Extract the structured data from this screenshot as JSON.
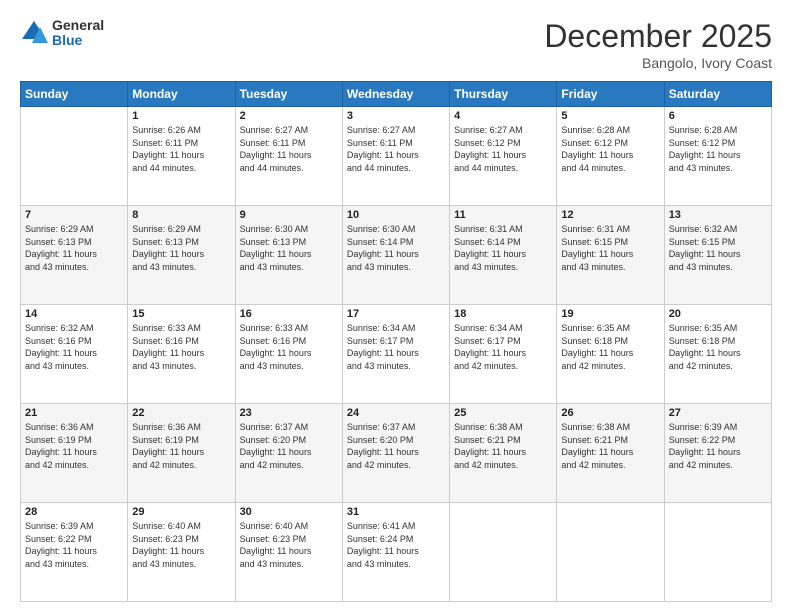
{
  "header": {
    "logo": {
      "general": "General",
      "blue": "Blue"
    },
    "title": "December 2025",
    "location": "Bangolo, Ivory Coast"
  },
  "calendar": {
    "days_of_week": [
      "Sunday",
      "Monday",
      "Tuesday",
      "Wednesday",
      "Thursday",
      "Friday",
      "Saturday"
    ],
    "weeks": [
      [
        {
          "day": "",
          "info": ""
        },
        {
          "day": "1",
          "info": "Sunrise: 6:26 AM\nSunset: 6:11 PM\nDaylight: 11 hours and 44 minutes."
        },
        {
          "day": "2",
          "info": "Sunrise: 6:27 AM\nSunset: 6:11 PM\nDaylight: 11 hours and 44 minutes."
        },
        {
          "day": "3",
          "info": "Sunrise: 6:27 AM\nSunset: 6:11 PM\nDaylight: 11 hours and 44 minutes."
        },
        {
          "day": "4",
          "info": "Sunrise: 6:27 AM\nSunset: 6:12 PM\nDaylight: 11 hours and 44 minutes."
        },
        {
          "day": "5",
          "info": "Sunrise: 6:28 AM\nSunset: 6:12 PM\nDaylight: 11 hours and 44 minutes."
        },
        {
          "day": "6",
          "info": "Sunrise: 6:28 AM\nSunset: 6:12 PM\nDaylight: 11 hours and 43 minutes."
        }
      ],
      [
        {
          "day": "7",
          "info": "Sunrise: 6:29 AM\nSunset: 6:13 PM\nDaylight: 11 hours and 43 minutes."
        },
        {
          "day": "8",
          "info": "Sunrise: 6:29 AM\nSunset: 6:13 PM\nDaylight: 11 hours and 43 minutes."
        },
        {
          "day": "9",
          "info": "Sunrise: 6:30 AM\nSunset: 6:13 PM\nDaylight: 11 hours and 43 minutes."
        },
        {
          "day": "10",
          "info": "Sunrise: 6:30 AM\nSunset: 6:14 PM\nDaylight: 11 hours and 43 minutes."
        },
        {
          "day": "11",
          "info": "Sunrise: 6:31 AM\nSunset: 6:14 PM\nDaylight: 11 hours and 43 minutes."
        },
        {
          "day": "12",
          "info": "Sunrise: 6:31 AM\nSunset: 6:15 PM\nDaylight: 11 hours and 43 minutes."
        },
        {
          "day": "13",
          "info": "Sunrise: 6:32 AM\nSunset: 6:15 PM\nDaylight: 11 hours and 43 minutes."
        }
      ],
      [
        {
          "day": "14",
          "info": "Sunrise: 6:32 AM\nSunset: 6:16 PM\nDaylight: 11 hours and 43 minutes."
        },
        {
          "day": "15",
          "info": "Sunrise: 6:33 AM\nSunset: 6:16 PM\nDaylight: 11 hours and 43 minutes."
        },
        {
          "day": "16",
          "info": "Sunrise: 6:33 AM\nSunset: 6:16 PM\nDaylight: 11 hours and 43 minutes."
        },
        {
          "day": "17",
          "info": "Sunrise: 6:34 AM\nSunset: 6:17 PM\nDaylight: 11 hours and 43 minutes."
        },
        {
          "day": "18",
          "info": "Sunrise: 6:34 AM\nSunset: 6:17 PM\nDaylight: 11 hours and 42 minutes."
        },
        {
          "day": "19",
          "info": "Sunrise: 6:35 AM\nSunset: 6:18 PM\nDaylight: 11 hours and 42 minutes."
        },
        {
          "day": "20",
          "info": "Sunrise: 6:35 AM\nSunset: 6:18 PM\nDaylight: 11 hours and 42 minutes."
        }
      ],
      [
        {
          "day": "21",
          "info": "Sunrise: 6:36 AM\nSunset: 6:19 PM\nDaylight: 11 hours and 42 minutes."
        },
        {
          "day": "22",
          "info": "Sunrise: 6:36 AM\nSunset: 6:19 PM\nDaylight: 11 hours and 42 minutes."
        },
        {
          "day": "23",
          "info": "Sunrise: 6:37 AM\nSunset: 6:20 PM\nDaylight: 11 hours and 42 minutes."
        },
        {
          "day": "24",
          "info": "Sunrise: 6:37 AM\nSunset: 6:20 PM\nDaylight: 11 hours and 42 minutes."
        },
        {
          "day": "25",
          "info": "Sunrise: 6:38 AM\nSunset: 6:21 PM\nDaylight: 11 hours and 42 minutes."
        },
        {
          "day": "26",
          "info": "Sunrise: 6:38 AM\nSunset: 6:21 PM\nDaylight: 11 hours and 42 minutes."
        },
        {
          "day": "27",
          "info": "Sunrise: 6:39 AM\nSunset: 6:22 PM\nDaylight: 11 hours and 42 minutes."
        }
      ],
      [
        {
          "day": "28",
          "info": "Sunrise: 6:39 AM\nSunset: 6:22 PM\nDaylight: 11 hours and 43 minutes."
        },
        {
          "day": "29",
          "info": "Sunrise: 6:40 AM\nSunset: 6:23 PM\nDaylight: 11 hours and 43 minutes."
        },
        {
          "day": "30",
          "info": "Sunrise: 6:40 AM\nSunset: 6:23 PM\nDaylight: 11 hours and 43 minutes."
        },
        {
          "day": "31",
          "info": "Sunrise: 6:41 AM\nSunset: 6:24 PM\nDaylight: 11 hours and 43 minutes."
        },
        {
          "day": "",
          "info": ""
        },
        {
          "day": "",
          "info": ""
        },
        {
          "day": "",
          "info": ""
        }
      ]
    ]
  }
}
